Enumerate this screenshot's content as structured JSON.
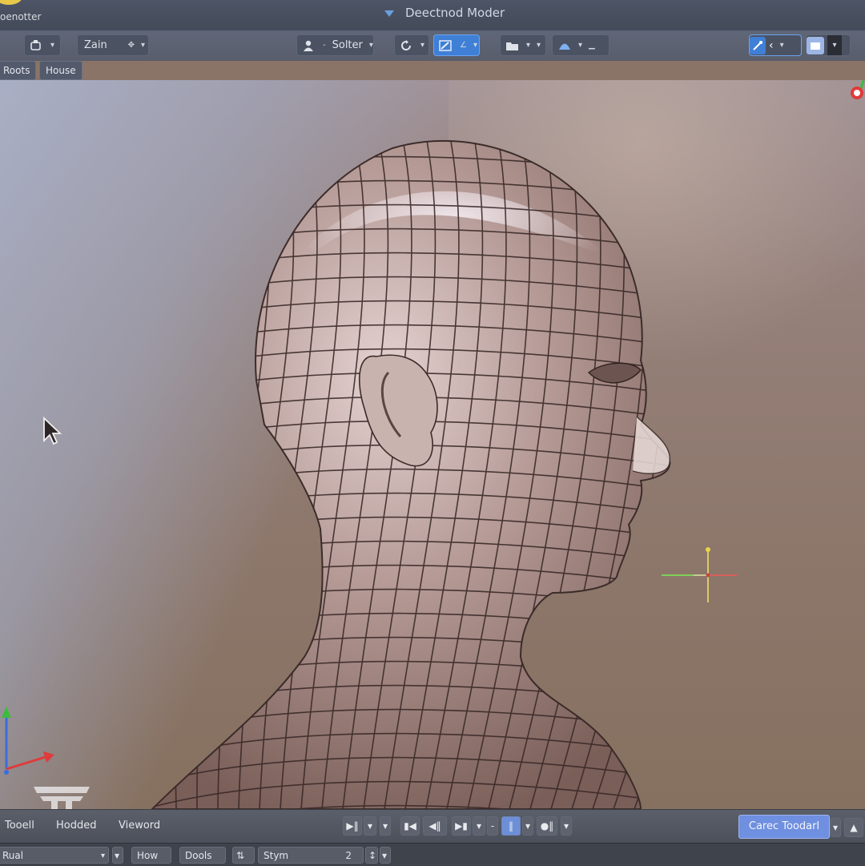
{
  "header": {
    "app_name": "oenotter",
    "mode_title": "Deectnod Moder"
  },
  "toolbar": {
    "view_zoom_label": "Zain",
    "select_label": "Solter"
  },
  "subbar": {
    "buttons": [
      "Roots",
      "House"
    ]
  },
  "viewport": {
    "axis_colors": {
      "x": "#e03a3a",
      "y": "#3dbb3d",
      "z": "#3a6ee0"
    }
  },
  "bottombar": {
    "tabs": [
      "Tooell",
      "Hodded",
      "Vieword"
    ],
    "primary_action": "Carec Toodarl"
  },
  "statusbar": {
    "mode_value": "Rual",
    "how_label": "How",
    "dools_label": "Dools",
    "stym_label": "Stym",
    "stym_value": "2"
  },
  "colors": {
    "accent": "#3f7fd6",
    "primary_button": "#6f8fe0"
  }
}
